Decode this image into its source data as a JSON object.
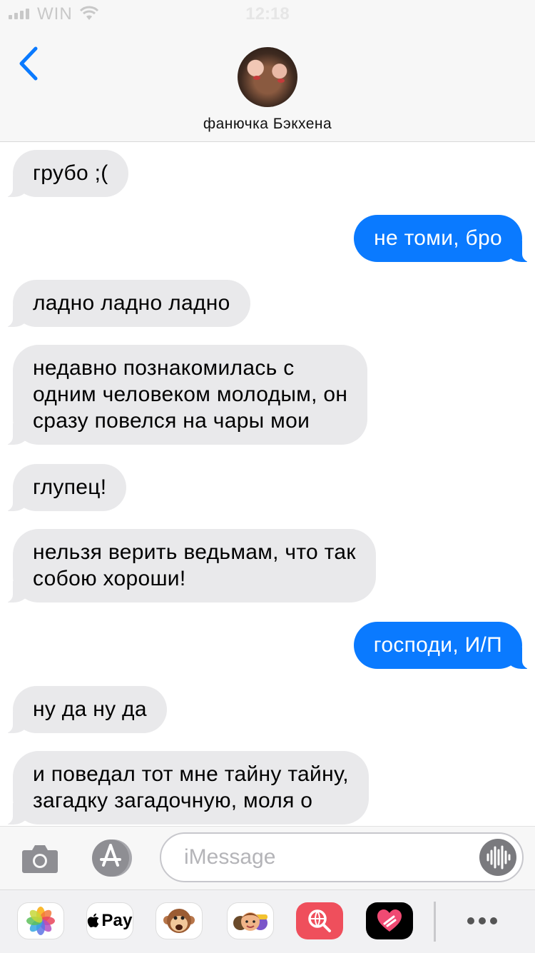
{
  "status_bar": {
    "carrier": "WIN",
    "time": "12:18"
  },
  "header": {
    "contact_name": "фанючка Бэкхена",
    "icons": {
      "back": "chevron-left-icon",
      "avatar": "contact-avatar"
    }
  },
  "messages": [
    {
      "direction": "incoming",
      "text": "грубо ;("
    },
    {
      "direction": "outgoing",
      "text": "не томи, бро"
    },
    {
      "direction": "incoming",
      "text": "ладно ладно ладно"
    },
    {
      "direction": "incoming",
      "text": "недавно познакомилась с\nодним человеком молодым, он\nсразу повелся на чары мои"
    },
    {
      "direction": "incoming",
      "text": "глупец!"
    },
    {
      "direction": "incoming",
      "text": "нельзя верить ведьмам, что так\nсобою хороши!"
    },
    {
      "direction": "outgoing",
      "text": "господи, И/П"
    },
    {
      "direction": "incoming",
      "text": "ну да ну да"
    },
    {
      "direction": "incoming",
      "text": "и поведал тот мне тайну тайну,\nзагадку загадочную, моля о"
    }
  ],
  "input_bar": {
    "placeholder": "iMessage",
    "icons": {
      "camera": "camera-icon",
      "apps": "app-store-icon",
      "audio": "audio-waveform-icon"
    }
  },
  "app_drawer": {
    "apple_pay_label": "Pay",
    "apps": [
      "photos-icon",
      "apple-pay-icon",
      "animoji-monkey-icon",
      "memoji-icon",
      "web-search-icon",
      "digital-touch-icon",
      "more-icon"
    ]
  },
  "colors": {
    "outgoing_bubble": "#0a7aff",
    "incoming_bubble": "#e9e9eb",
    "accent": "#0a7aff"
  }
}
